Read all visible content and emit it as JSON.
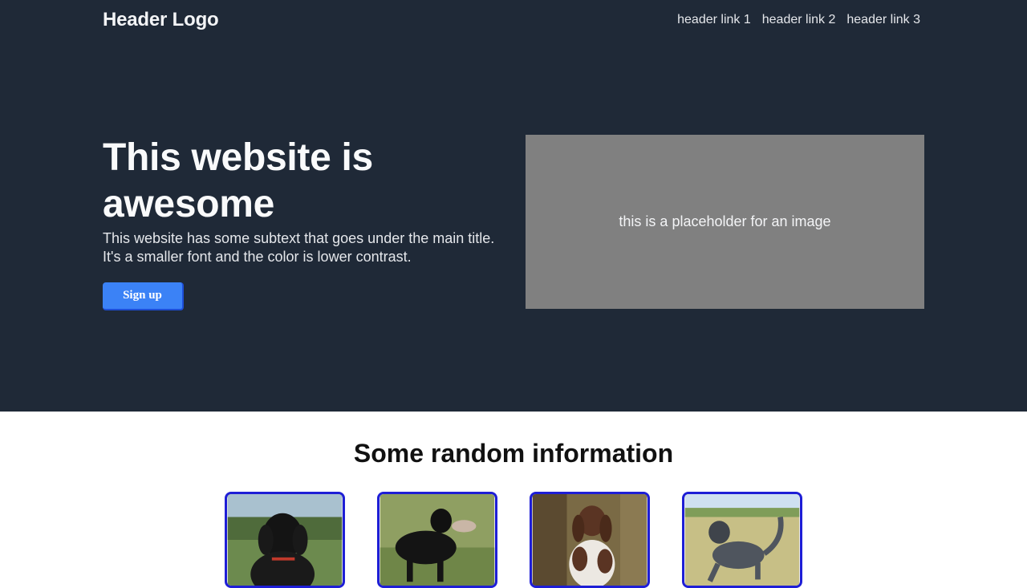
{
  "header": {
    "logo": "Header Logo",
    "links": [
      "header link 1",
      "header link 2",
      "header link 3"
    ]
  },
  "hero": {
    "title": "This website is awesome",
    "subtitle": "This website has some subtext that goes under the main title. It's a smaller font and the color is lower contrast.",
    "button_label": "Sign up",
    "placeholder_text": "this is a placeholder for an image"
  },
  "info": {
    "title": "Some random information",
    "cards": [
      {
        "image": "black-poodle-photo"
      },
      {
        "image": "black-dog-with-bird-photo"
      },
      {
        "image": "brown-white-spaniel-photo"
      },
      {
        "image": "gray-poodle-running-photo"
      }
    ]
  },
  "colors": {
    "hero_bg": "#1f2937",
    "button": "#3b82f6",
    "placeholder": "#808080",
    "card_border": "#1e1ed6"
  }
}
